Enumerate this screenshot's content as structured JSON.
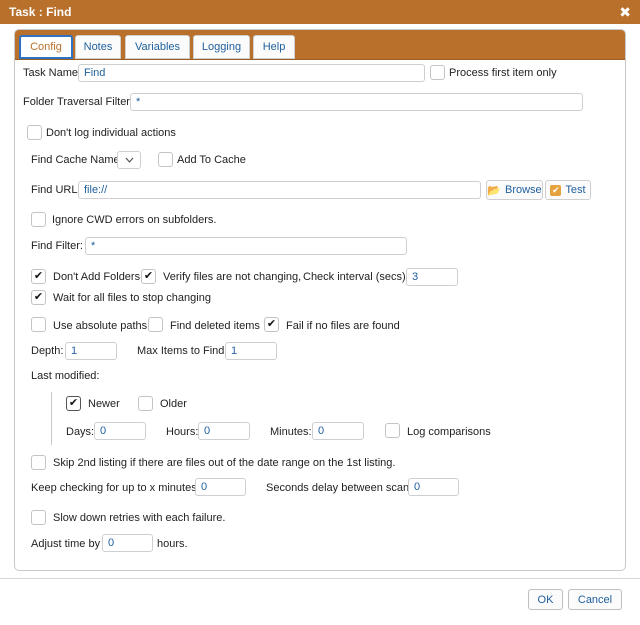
{
  "window": {
    "title": "Task : Find",
    "close_glyph": "✖"
  },
  "tabs": [
    {
      "label": "Config",
      "active": true
    },
    {
      "label": "Notes"
    },
    {
      "label": "Variables"
    },
    {
      "label": "Logging"
    },
    {
      "label": "Help"
    }
  ],
  "fields": {
    "task_name": {
      "label": "Task Name:",
      "value": "Find"
    },
    "process_first_item": {
      "label": "Process first item only",
      "checked": false
    },
    "folder_traversal_filter": {
      "label": "Folder Traversal Filter:",
      "value": "*"
    },
    "dont_log_actions": {
      "label": "Don't log individual actions",
      "checked": false
    },
    "find_cache_name": {
      "label": "Find Cache Name:",
      "value": ""
    },
    "add_to_cache": {
      "label": "Add To Cache",
      "checked": false
    },
    "find_url": {
      "label": "Find URL:",
      "value": "file://"
    },
    "browse_button": {
      "label": "Browse",
      "icon": "folder-open-icon"
    },
    "test_button": {
      "label": "Test",
      "icon": "check-badge-icon"
    },
    "ignore_cwd_errors": {
      "label": "Ignore CWD errors on subfolders.",
      "checked": false
    },
    "find_filter": {
      "label": "Find Filter:",
      "value": "*"
    },
    "dont_add_folders": {
      "label": "Don't Add Folders",
      "checked": true
    },
    "verify_files": {
      "label": "Verify files are not changing,",
      "checked": true
    },
    "check_interval": {
      "label": "Check interval (secs):",
      "value": "3"
    },
    "wait_for_files": {
      "label": "Wait for all files to stop changing",
      "checked": true
    },
    "use_absolute_paths": {
      "label": "Use absolute paths",
      "checked": false
    },
    "find_deleted_items": {
      "label": "Find deleted items",
      "checked": false
    },
    "fail_if_no_files": {
      "label": "Fail if no files are found",
      "checked": true
    },
    "depth": {
      "label": "Depth:",
      "value": "1"
    },
    "max_items": {
      "label": "Max Items to Find:",
      "value": "1"
    },
    "last_modified": {
      "label": "Last modified:"
    },
    "newer": {
      "label": "Newer",
      "checked": true
    },
    "older": {
      "label": "Older",
      "checked": false
    },
    "days": {
      "label": "Days:",
      "value": "0"
    },
    "hours": {
      "label": "Hours:",
      "value": "0"
    },
    "minutes": {
      "label": "Minutes:",
      "value": "0"
    },
    "log_comparisons": {
      "label": "Log comparisons",
      "checked": false
    },
    "skip_2nd_listing": {
      "label": "Skip 2nd listing if there are files out of the date range on the 1st listing.",
      "checked": false
    },
    "keep_checking": {
      "label": "Keep checking for up to x minutes:",
      "value": "0"
    },
    "seconds_delay": {
      "label": "Seconds delay between scans:",
      "value": "0"
    },
    "slow_down_retries": {
      "label": "Slow down retries with each failure.",
      "checked": false
    },
    "adjust_time_prefix": {
      "label": "Adjust time by",
      "value": "0"
    },
    "adjust_time_suffix": {
      "label": "hours."
    }
  },
  "footer": {
    "ok_label": "OK",
    "cancel_label": "Cancel"
  },
  "colors": {
    "accent": "#b8702a",
    "link": "#1f5f9c",
    "focus": "#2d72c3"
  },
  "check_glyph": "✔"
}
